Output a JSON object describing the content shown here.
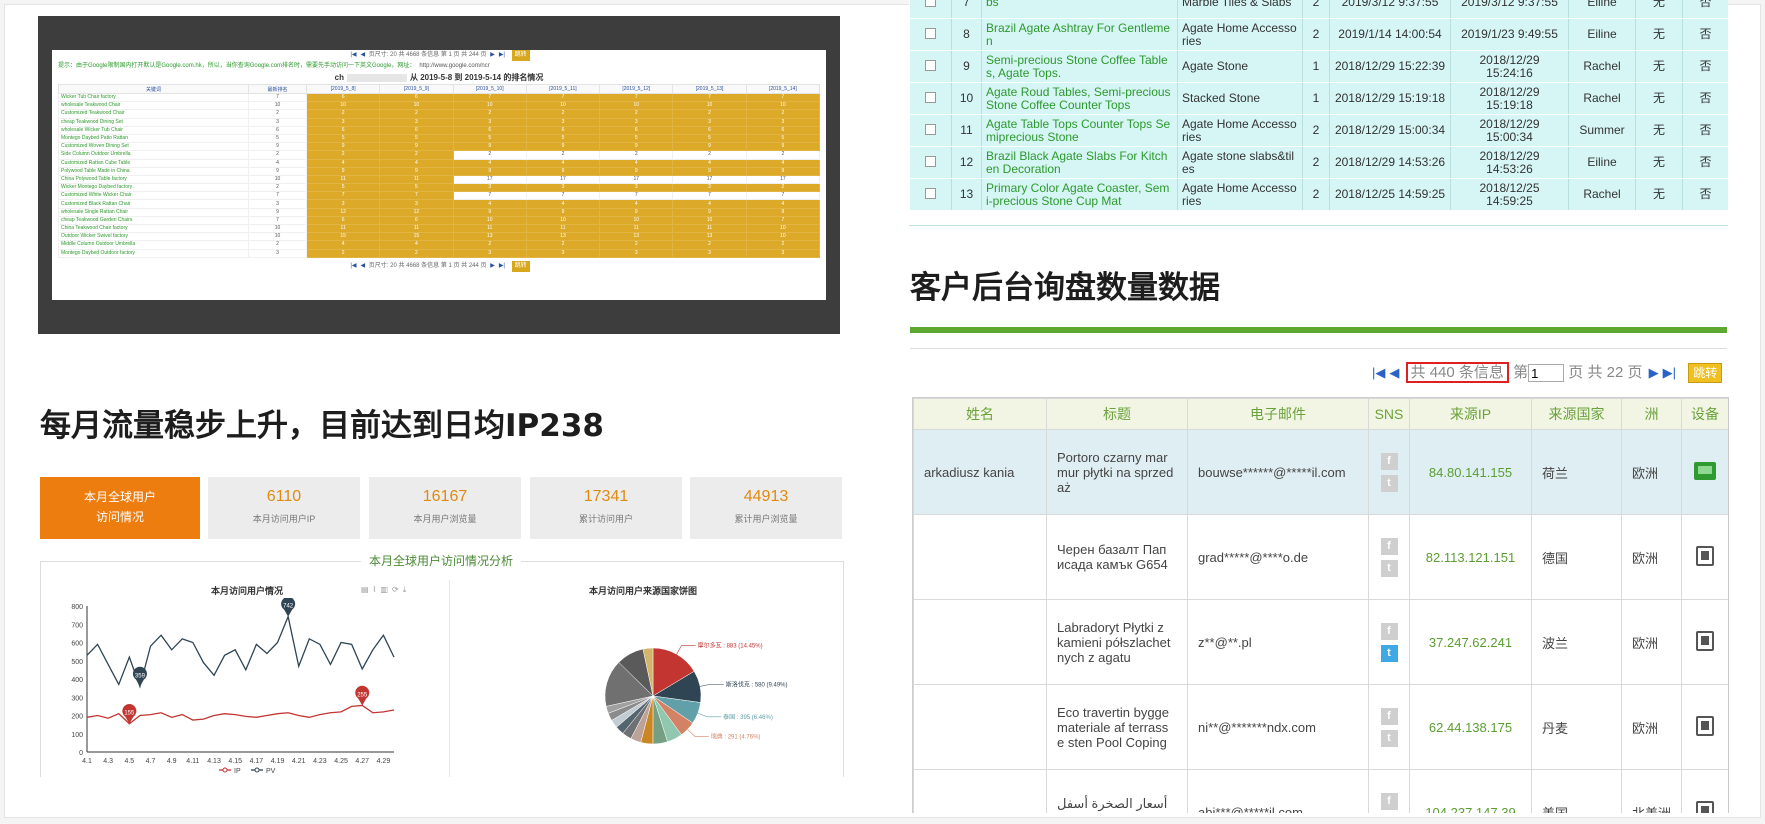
{
  "rank_panel": {
    "pager_text": "页尺寸: 20 共 4668 条信息 第 1 页 共 244 页",
    "go_label": "跳转",
    "notice": "提示：由于Google限制国内打开默认是Google.com.hk，所以，当你查询Google.com排名时，需要先手动访问一下英文Google，网址：",
    "notice_url": "http://www.google.com/ncr",
    "title_prefix": "ch",
    "title_suffix": "从 2019-5-8 到 2019-5-14 的排名情况",
    "columns": [
      "关键词",
      "最新排名",
      "[2019_5_8]",
      "[2019_5_9]",
      "[2019_5_10]",
      "[2019_5_11]",
      "[2019_5_12]",
      "[2019_5_13]",
      "[2019_5_14]"
    ],
    "rows": [
      {
        "kw": "Wicker Tub Chair factory",
        "r": "7",
        "v": [
          "6",
          "6",
          "7",
          "7",
          "7",
          "7",
          "7"
        ],
        "g": [
          1,
          1,
          1,
          1,
          1,
          1,
          1
        ]
      },
      {
        "kw": "wholesale Teakwood Chair",
        "r": "10",
        "v": [
          "10",
          "10",
          "10",
          "10",
          "10",
          "10",
          "10"
        ],
        "g": [
          1,
          1,
          1,
          1,
          1,
          1,
          1
        ]
      },
      {
        "kw": "Customized Teakwood Chair",
        "r": "2",
        "v": [
          "2",
          "2",
          "2",
          "2",
          "2",
          "2",
          "2"
        ],
        "g": [
          1,
          1,
          1,
          1,
          1,
          1,
          1
        ]
      },
      {
        "kw": "cheap Teakwood Dining Set",
        "r": "3",
        "v": [
          "3",
          "3",
          "3",
          "3",
          "3",
          "3",
          "3"
        ],
        "g": [
          1,
          1,
          1,
          1,
          1,
          1,
          1
        ]
      },
      {
        "kw": "wholesale Wicker Tub Chair",
        "r": "6",
        "v": [
          "6",
          "6",
          "6",
          "6",
          "6",
          "6",
          "6"
        ],
        "g": [
          1,
          1,
          1,
          1,
          1,
          1,
          1
        ]
      },
      {
        "kw": "Montego Daybed Patio Rattan",
        "r": "5",
        "v": [
          "5",
          "5",
          "5",
          "5",
          "5",
          "5",
          "5"
        ],
        "g": [
          1,
          1,
          1,
          1,
          1,
          1,
          1
        ]
      },
      {
        "kw": "Customized Woven Dining Set",
        "r": "9",
        "v": [
          "9",
          "9",
          "9",
          "9",
          "9",
          "9",
          "9"
        ],
        "g": [
          1,
          1,
          1,
          1,
          1,
          1,
          1
        ]
      },
      {
        "kw": "Side Column Outdoor Umbrella",
        "r": "2",
        "v": [
          "2",
          "2",
          "2",
          "2",
          "2",
          "2",
          "2"
        ],
        "g": [
          1,
          1,
          0,
          0,
          0,
          0,
          0
        ]
      },
      {
        "kw": "Customized Rattan Cube Table",
        "r": "4",
        "v": [
          "4",
          "4",
          "4",
          "4",
          "4",
          "4",
          "4"
        ],
        "g": [
          1,
          1,
          1,
          1,
          1,
          1,
          1
        ]
      },
      {
        "kw": "Polywood Table Made in China",
        "r": "9",
        "v": [
          "9",
          "9",
          "9",
          "9",
          "9",
          "9",
          "9"
        ],
        "g": [
          1,
          1,
          1,
          1,
          1,
          1,
          1
        ]
      },
      {
        "kw": "China Polywood Table factory",
        "r": "10",
        "v": [
          "11",
          "11",
          "17",
          "17",
          "17",
          "17",
          "17"
        ],
        "g": [
          1,
          1,
          0,
          0,
          0,
          0,
          0
        ]
      },
      {
        "kw": "Wicker Montego Daybed factory",
        "r": "2",
        "v": [
          "5",
          "5",
          "3",
          "3",
          "3",
          "3",
          "2"
        ],
        "g": [
          1,
          1,
          1,
          1,
          1,
          1,
          1
        ]
      },
      {
        "kw": "Customized White Wicker Chair",
        "r": "7",
        "v": [
          "7",
          "7",
          "7",
          "7",
          "7",
          "7",
          "7"
        ],
        "g": [
          1,
          1,
          0,
          0,
          0,
          0,
          0
        ]
      },
      {
        "kw": "Customized Black Rattan Chair",
        "r": "3",
        "v": [
          "3",
          "3",
          "4",
          "4",
          "4",
          "4",
          "4"
        ],
        "g": [
          1,
          1,
          1,
          1,
          1,
          1,
          1
        ]
      },
      {
        "kw": "wholesale Single Rattan Chair",
        "r": "9",
        "v": [
          "12",
          "12",
          "9",
          "9",
          "9",
          "9",
          "9"
        ],
        "g": [
          1,
          1,
          1,
          1,
          1,
          1,
          1
        ]
      },
      {
        "kw": "cheap Teakwood Garden Chairs",
        "r": "7",
        "v": [
          "6",
          "6",
          "10",
          "10",
          "10",
          "10",
          "7"
        ],
        "g": [
          1,
          1,
          1,
          1,
          1,
          1,
          1
        ]
      },
      {
        "kw": "China Teakwood Chair factory",
        "r": "10",
        "v": [
          "11",
          "11",
          "11",
          "11",
          "11",
          "11",
          "10"
        ],
        "g": [
          1,
          1,
          1,
          1,
          1,
          1,
          1
        ]
      },
      {
        "kw": "Outdoor Wicker Swivel factory",
        "r": "10",
        "v": [
          "15",
          "15",
          "13",
          "13",
          "13",
          "13",
          "10"
        ],
        "g": [
          1,
          1,
          1,
          1,
          1,
          1,
          1
        ]
      },
      {
        "kw": "Middle Column Outdoor Umbrella",
        "r": "2",
        "v": [
          "4",
          "4",
          "2",
          "2",
          "2",
          "2",
          "2"
        ],
        "g": [
          1,
          1,
          1,
          1,
          1,
          1,
          1
        ]
      },
      {
        "kw": "Montego Daybed Outdoor factory",
        "r": "3",
        "v": [
          "2",
          "2",
          "3",
          "3",
          "3",
          "3",
          "3"
        ],
        "g": [
          1,
          1,
          1,
          1,
          1,
          1,
          1
        ]
      }
    ]
  },
  "left_headline": "每月流量稳步上升，目前达到日均IP238",
  "stats": {
    "main_label_1": "本月全球用户",
    "main_label_2": "访问情况",
    "items": [
      {
        "value": "6110",
        "label": "本月访问用户IP"
      },
      {
        "value": "16167",
        "label": "本月用户浏览量"
      },
      {
        "value": "17341",
        "label": "累计访问用户"
      },
      {
        "value": "44913",
        "label": "累计用户浏览量"
      }
    ]
  },
  "chart_section_title": "本月全球用户访问情况分析",
  "chart_data": [
    {
      "type": "line",
      "title": "本月访问用户情况",
      "x": [
        "4.1",
        "4.2",
        "4.3",
        "4.4",
        "4.5",
        "4.6",
        "4.7",
        "4.8",
        "4.9",
        "4.10",
        "4.11",
        "4.12",
        "4.13",
        "4.14",
        "4.15",
        "4.16",
        "4.17",
        "4.18",
        "4.19",
        "4.20",
        "4.21",
        "4.22",
        "4.23",
        "4.24",
        "4.25",
        "4.26",
        "4.27",
        "4.28",
        "4.29",
        "4.30"
      ],
      "xticks": [
        "4.1",
        "4.3",
        "4.5",
        "4.7",
        "4.9",
        "4.11",
        "4.13",
        "4.15",
        "4.17",
        "4.19",
        "4.21",
        "4.23",
        "4.25",
        "4.27",
        "4.29"
      ],
      "ylim": [
        0,
        800
      ],
      "yticks": [
        0,
        100,
        200,
        300,
        400,
        500,
        600,
        700,
        800
      ],
      "series": [
        {
          "name": "IP",
          "color": "#c23531",
          "values": [
            190,
            200,
            185,
            210,
            155,
            200,
            205,
            215,
            190,
            205,
            175,
            180,
            200,
            210,
            205,
            195,
            190,
            200,
            210,
            215,
            200,
            190,
            205,
            215,
            220,
            250,
            255,
            215,
            220,
            230
          ]
        },
        {
          "name": "PV",
          "color": "#2f4554",
          "values": [
            530,
            590,
            480,
            370,
            520,
            359,
            580,
            640,
            560,
            620,
            600,
            490,
            420,
            530,
            560,
            450,
            590,
            540,
            600,
            742,
            470,
            620,
            590,
            480,
            600,
            590,
            455,
            560,
            640,
            520
          ]
        }
      ],
      "markers": [
        {
          "series": "PV",
          "index": 5,
          "label": "359"
        },
        {
          "series": "PV",
          "index": 19,
          "label": "742"
        },
        {
          "series": "IP",
          "index": 4,
          "label": "155"
        },
        {
          "series": "IP",
          "index": 26,
          "label": "255"
        }
      ]
    },
    {
      "type": "pie",
      "title": "本月访问用户来源国家饼图",
      "slices": [
        {
          "name": "摩尔多瓦",
          "value": 883,
          "label": "摩尔多瓦 : 883 (14.45%)",
          "color": "#c23531"
        },
        {
          "name": "斯洛伐克",
          "value": 580,
          "label": "斯洛伐克 : 580 (9.49%)",
          "color": "#2f4554"
        },
        {
          "name": "泰国",
          "value": 395,
          "label": "泰国 : 395 (6.46%)",
          "color": "#61a0a8"
        },
        {
          "name": "瑞典",
          "value": 291,
          "label": "瑞典 : 291 (4.76%)",
          "color": "#d48265"
        },
        {
          "name": "其他1",
          "value": 280,
          "label": "",
          "color": "#91c7ae"
        },
        {
          "name": "其他2",
          "value": 264,
          "label": "",
          "color": "#749f83"
        },
        {
          "name": "其他3",
          "value": 220,
          "label": "",
          "color": "#ca8622"
        },
        {
          "name": "其他4",
          "value": 190,
          "label": "",
          "color": "#bda29a"
        },
        {
          "name": "其他5",
          "value": 170,
          "label": "",
          "color": "#6e7074"
        },
        {
          "name": "其他6",
          "value": 158,
          "label": "",
          "color": "#546570"
        },
        {
          "name": "其他7",
          "value": 150,
          "label": "",
          "color": "#c4ccd3"
        },
        {
          "name": "其他8",
          "value": 140,
          "label": "",
          "color": "#8b8b8b"
        },
        {
          "name": "其他9",
          "value": 130,
          "label": "",
          "color": "#a0a0a0"
        },
        {
          "name": "其他10",
          "value": 852,
          "label": "",
          "color": "#707070"
        },
        {
          "name": "其他11",
          "value": 500,
          "label": "",
          "color": "#5a5a5a"
        },
        {
          "name": "其他12",
          "value": 180,
          "label": "",
          "color": "#d4b36a"
        }
      ]
    }
  ],
  "records": {
    "rows": [
      {
        "no": "7",
        "title": "bs",
        "cat": "Marble Tiles & Slabs",
        "qty": "2",
        "t1": "2019/3/12 9:37:55",
        "t2": "2019/3/12 9:37:55",
        "user": "Eiline",
        "a": "无",
        "b": "否"
      },
      {
        "no": "8",
        "title": "Brazil Agate Ashtray For Gentleme n",
        "cat": "Agate Home Accesso ries",
        "qty": "2",
        "t1": "2019/1/14 14:00:54",
        "t2": "2019/1/23 9:49:55",
        "user": "Eiline",
        "a": "无",
        "b": "否"
      },
      {
        "no": "9",
        "title": "Semi-precious Stone Coffee Table s, Agate Tops.",
        "cat": "Agate Stone",
        "qty": "1",
        "t1": "2018/12/29 15:22:39",
        "t2": "2018/12/29 15:24:16",
        "user": "Rachel",
        "a": "无",
        "b": "否"
      },
      {
        "no": "10",
        "title": "Agate Roud Tables, Semi-precious Stone Coffee Counter Tops",
        "cat": "Stacked Stone",
        "qty": "1",
        "t1": "2018/12/29 15:19:18",
        "t2": "2018/12/29 15:19:18",
        "user": "Rachel",
        "a": "无",
        "b": "否"
      },
      {
        "no": "11",
        "title": "Agate Table Tops Counter Tops Se miprecious Stone",
        "cat": "Agate Home Accesso ries",
        "qty": "2",
        "t1": "2018/12/29 15:00:34",
        "t2": "2018/12/29 15:00:34",
        "user": "Summer",
        "a": "无",
        "b": "否"
      },
      {
        "no": "12",
        "title": "Brazil Black Agate Slabs For Kitch en Decoration",
        "cat": "Agate stone slabs&til es",
        "qty": "2",
        "t1": "2018/12/29 14:53:26",
        "t2": "2018/12/29 14:53:26",
        "user": "Eiline",
        "a": "无",
        "b": "否"
      },
      {
        "no": "13",
        "title": "Primary Color Agate Coaster, Sem i-precious Stone Cup Mat",
        "cat": "Agate Home Accesso ries",
        "qty": "2",
        "t1": "2018/12/25 14:59:25",
        "t2": "2018/12/25 14:59:25",
        "user": "Rachel",
        "a": "无",
        "b": "否"
      }
    ]
  },
  "right_headline": "客户后台询盘数量数据",
  "pager": {
    "total": "共 440 条信息",
    "page_prefix": "第",
    "page_value": "1",
    "page_suffix": "页 共 22 页",
    "go_label": "跳转"
  },
  "inquiries": {
    "columns": [
      "姓名",
      "标题",
      "电子邮件",
      "SNS",
      "来源IP",
      "来源国家",
      "洲",
      "设备"
    ],
    "rows": [
      {
        "name": "arkadiusz kania",
        "title": "Portoro czarny mar mur płytki na sprzed aż",
        "email": "bouwse******@*****il.com",
        "tw_on": false,
        "ip": "84.80.141.155",
        "country": "荷兰",
        "continent": "欧洲",
        "device": "pc",
        "selected": true
      },
      {
        "name": "",
        "title": "Черен базалт Пап исада камък G654",
        "email": "grad*****@****o.de",
        "tw_on": false,
        "ip": "82.113.121.151",
        "country": "德国",
        "continent": "欧洲",
        "device": "mobile",
        "selected": false
      },
      {
        "name": "",
        "title": "Labradoryt Płytki z kamieni półszlachet nych z agatu",
        "email": "z**@**.pl",
        "tw_on": true,
        "ip": "37.247.62.241",
        "country": "波兰",
        "continent": "欧洲",
        "device": "mobile",
        "selected": false
      },
      {
        "name": "",
        "title": "Eco travertin bygge materiale af terrass e sten Pool Coping",
        "email": "ni**@*******ndx.com",
        "tw_on": false,
        "ip": "62.44.138.175",
        "country": "丹麦",
        "continent": "欧洲",
        "device": "mobile",
        "selected": false
      },
      {
        "name": "",
        "title": "أسعار الصخرة أسفل مصنع الرخام الطبيعي",
        "email": "abi***@*****il.com",
        "tw_on": false,
        "ip": "104.237.147.39",
        "country": "美国",
        "continent": "北美洲",
        "device": "mobile",
        "selected": false
      }
    ]
  }
}
